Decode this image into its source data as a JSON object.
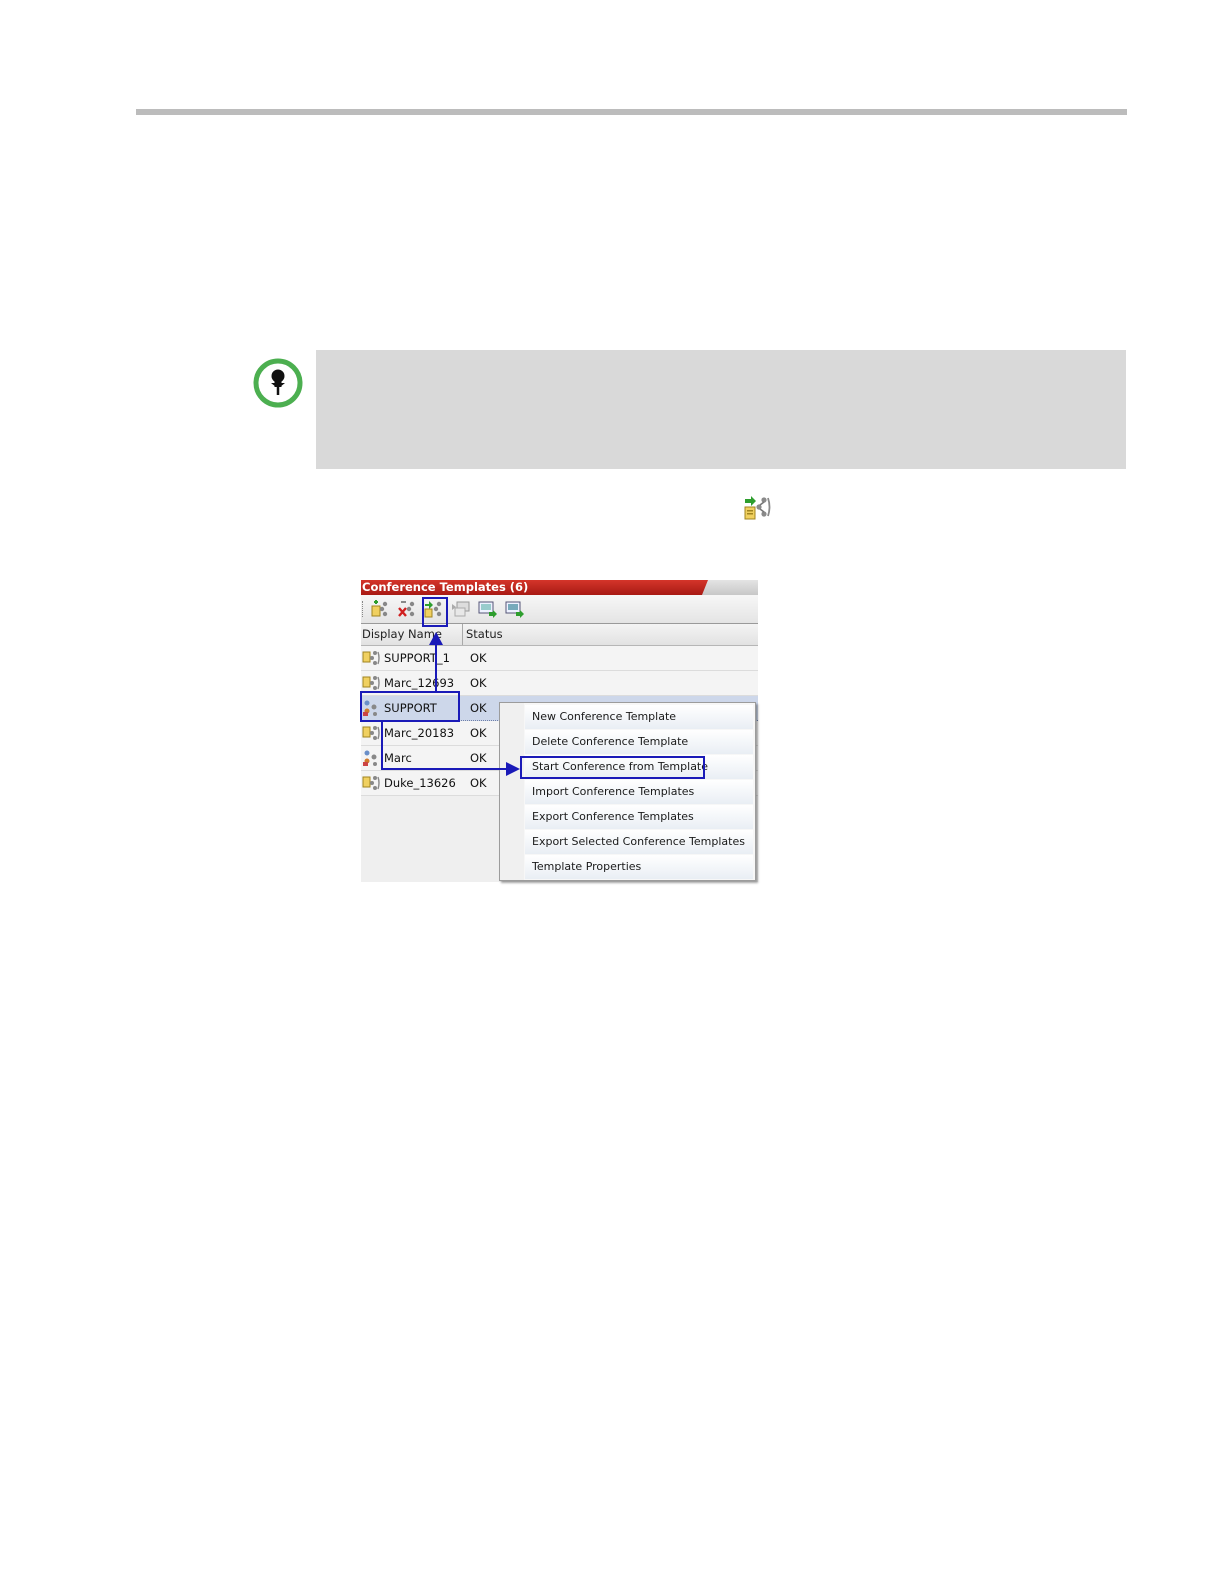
{
  "note": {
    "icon": "pushpin-note-icon",
    "icon_color": "#4caf50"
  },
  "inline_icon": "start-conference-from-template-icon",
  "panel": {
    "title": "Conference Templates (6)",
    "toolbar_icons": [
      "new-conference-template-icon",
      "delete-conference-template-icon",
      "start-conference-from-template-icon",
      "import-templates-icon",
      "export-templates-icon",
      "export-selected-templates-icon"
    ],
    "columns": {
      "name": "Display Name",
      "status": "Status"
    },
    "rows": [
      {
        "name": "SUPPORT_1",
        "status": "OK",
        "icon": "template-icon"
      },
      {
        "name": "Marc_12693",
        "status": "OK",
        "icon": "template-icon"
      },
      {
        "name": "SUPPORT",
        "status": "OK",
        "icon": "template-group-icon"
      },
      {
        "name": "Marc_20183",
        "status": "OK",
        "icon": "template-icon"
      },
      {
        "name": "Marc",
        "status": "OK",
        "icon": "template-group-icon"
      },
      {
        "name": "Duke_13626",
        "status": "OK",
        "icon": "template-icon"
      }
    ],
    "selected_row": "SUPPORT"
  },
  "context_menu": {
    "items": [
      "New Conference Template",
      "Delete Conference Template",
      "Start Conference from Template",
      "Import Conference Templates",
      "Export Conference Templates",
      "Export Selected Conference Templates",
      "Template Properties"
    ],
    "highlighted": "Start Conference from Template"
  },
  "colors": {
    "title_bar": "#b8201a",
    "callout": "#1a1ab8",
    "rule": "#bcbcbc",
    "note_bg": "#d9d9d9"
  }
}
